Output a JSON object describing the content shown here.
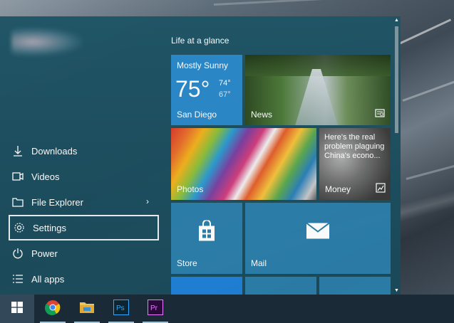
{
  "start_menu": {
    "left": {
      "items": [
        {
          "label": "Downloads",
          "icon": "download-icon"
        },
        {
          "label": "Videos",
          "icon": "video-icon"
        },
        {
          "label": "File Explorer",
          "icon": "folder-icon"
        },
        {
          "label": "Settings",
          "icon": "gear-icon"
        },
        {
          "label": "Power",
          "icon": "power-icon"
        },
        {
          "label": "All apps",
          "icon": "list-icon"
        }
      ]
    },
    "group_title": "Life at a glance",
    "tiles": {
      "weather": {
        "condition": "Mostly Sunny",
        "temp": "75°",
        "high": "74°",
        "low": "67°",
        "city": "San Diego"
      },
      "news": {
        "label": "News"
      },
      "photos": {
        "label": "Photos"
      },
      "money": {
        "headline": "Here's the real problem plaguing China's econo...",
        "label": "Money"
      },
      "store": {
        "label": "Store"
      },
      "mail": {
        "label": "Mail"
      }
    }
  },
  "taskbar": {
    "apps": [
      "Google Chrome",
      "File Explorer",
      "Photoshop",
      "Premiere"
    ]
  },
  "colors": {
    "start_bg": "#1f5566",
    "tile_blue": "#2a7da9",
    "weather_blue": "#2a88c9",
    "taskbar": "#1a2a36"
  }
}
